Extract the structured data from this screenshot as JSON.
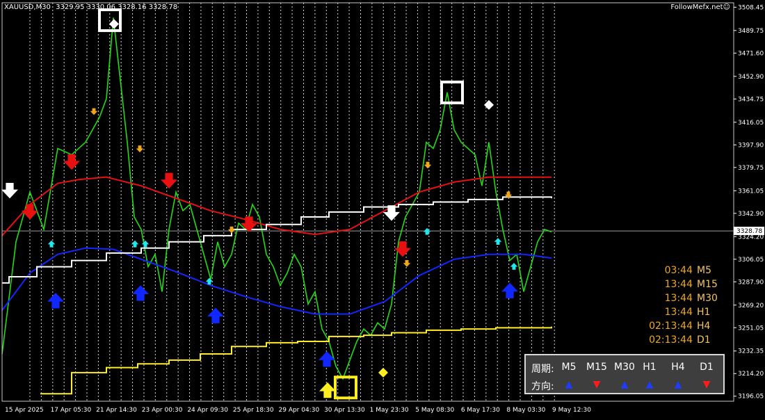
{
  "window": {
    "symbol": "XAUUSD,M30",
    "ohlc": "3329.95 3330.06 3328.16 3328.78",
    "brand": "FollowMefx.net",
    "brand_icon": "smiley-icon"
  },
  "current_price_label": "3328.78",
  "timeframe_list": [
    {
      "time": "03:44",
      "tf": "M5"
    },
    {
      "time": "13:44",
      "tf": "M15"
    },
    {
      "time": "13:44",
      "tf": "M30"
    },
    {
      "time": "13:44",
      "tf": "H1"
    },
    {
      "time": "02:13:44",
      "tf": "H4"
    },
    {
      "time": "02:13:44",
      "tf": "D1"
    }
  ],
  "direction_panel": {
    "period_label": "周期:",
    "direction_label": "方向:",
    "columns": [
      {
        "tf": "M5",
        "dir": "up",
        "glyph": "▲"
      },
      {
        "tf": "M15",
        "dir": "down",
        "glyph": "▼"
      },
      {
        "tf": "M30",
        "dir": "up",
        "glyph": "▲"
      },
      {
        "tf": "H1",
        "dir": "up",
        "glyph": "▲"
      },
      {
        "tf": "H4",
        "dir": "up",
        "glyph": "▲"
      },
      {
        "tf": "D1",
        "dir": "down",
        "glyph": "▼"
      }
    ]
  },
  "colors": {
    "background": "#000000",
    "price": "#22dd11",
    "red_ma": "#e81010",
    "blue_ma": "#1028ff",
    "white_step": "#ffffff",
    "yellow_step": "#ffee22",
    "orange_arrow": "#f0a818",
    "cyan_arrow": "#22e8ee",
    "up_dir": "#1f3bff",
    "down_dir": "#ff1b1b"
  },
  "chart_data": {
    "type": "line",
    "title": "",
    "y_ticks": [
      "3508.45",
      "3489.75",
      "3471.60",
      "3452.90",
      "3434.75",
      "3416.05",
      "3397.90",
      "3379.75",
      "3361.05",
      "3342.90",
      "3324.20",
      "3306.05",
      "3287.90",
      "3269.20",
      "3251.05",
      "3232.35",
      "3214.20",
      "3196.05"
    ],
    "x_ticks": [
      "15 Apr 2025",
      "17 Apr 05:30",
      "21 Apr 14:30",
      "23 Apr 00:30",
      "24 Apr 09:30",
      "25 Apr 18:30",
      "29 Apr 04:30",
      "30 Apr 13:30",
      "1 May 23:30",
      "5 May 08:30",
      "6 May 17:30",
      "8 May 03:30",
      "9 May 12:30"
    ],
    "ylim": [
      3192,
      3512
    ],
    "grid": "vertical-dotted",
    "last_price": 3328.78,
    "series": [
      {
        "name": "",
        "style": "price-line",
        "x": [
          0,
          20,
          40,
          60,
          80,
          100,
          120,
          140,
          150,
          160,
          170,
          180,
          190,
          200,
          210,
          220,
          230,
          240,
          250,
          260,
          270,
          280,
          290,
          300,
          310,
          320,
          330,
          340,
          350,
          360,
          370,
          380,
          390,
          400,
          410,
          420,
          430,
          440,
          450,
          460,
          470,
          480,
          490,
          500,
          510,
          520,
          530,
          540,
          550,
          560,
          570,
          580,
          590,
          600,
          610,
          620,
          630,
          640,
          650,
          660,
          670,
          680,
          690,
          700,
          710,
          720,
          730,
          740,
          750,
          760,
          770,
          780,
          790
        ],
        "y": [
          3230,
          3320,
          3360,
          3330,
          3395,
          3390,
          3400,
          3420,
          3435,
          3500,
          3450,
          3400,
          3340,
          3330,
          3300,
          3310,
          3280,
          3330,
          3360,
          3345,
          3350,
          3330,
          3310,
          3290,
          3320,
          3300,
          3310,
          3335,
          3330,
          3350,
          3340,
          3310,
          3300,
          3285,
          3295,
          3310,
          3300,
          3270,
          3280,
          3250,
          3240,
          3220,
          3210,
          3225,
          3240,
          3250,
          3245,
          3255,
          3250,
          3270,
          3320,
          3340,
          3350,
          3360,
          3400,
          3395,
          3410,
          3440,
          3410,
          3400,
          3395,
          3390,
          3365,
          3400,
          3360,
          3330,
          3305,
          3310,
          3280,
          3300,
          3320,
          3330,
          3328
        ]
      },
      {
        "name": "",
        "style": "red-ma",
        "x": [
          0,
          40,
          80,
          110,
          150,
          200,
          250,
          300,
          350,
          400,
          450,
          500,
          550,
          600,
          650,
          700,
          720,
          790
        ],
        "y": [
          3325,
          3350,
          3367,
          3370,
          3372,
          3365,
          3355,
          3345,
          3338,
          3330,
          3326,
          3330,
          3345,
          3360,
          3368,
          3372,
          3372,
          3372
        ]
      },
      {
        "name": "",
        "style": "blue-ma",
        "x": [
          0,
          40,
          80,
          120,
          160,
          200,
          250,
          300,
          350,
          400,
          450,
          500,
          550,
          600,
          650,
          700,
          750,
          790
        ],
        "y": [
          3265,
          3295,
          3310,
          3315,
          3314,
          3306,
          3296,
          3285,
          3276,
          3268,
          3262,
          3262,
          3272,
          3293,
          3306,
          3310,
          3310,
          3307
        ]
      },
      {
        "name": "",
        "style": "white-step",
        "x": [
          0,
          10,
          50,
          100,
          150,
          200,
          240,
          290,
          330,
          380,
          430,
          470,
          520,
          570,
          620,
          670,
          720,
          790
        ],
        "y": [
          3287,
          3292,
          3300,
          3305,
          3311,
          3315,
          3320,
          3325,
          3330,
          3334,
          3340,
          3344,
          3348,
          3350,
          3352,
          3354,
          3356,
          3355
        ]
      },
      {
        "name": "",
        "style": "yellow-step",
        "x": [
          55,
          100,
          150,
          195,
          240,
          285,
          330,
          380,
          425,
          470,
          520,
          560,
          610,
          660,
          710,
          790
        ],
        "y": [
          3198,
          3215,
          3219,
          3222,
          3225,
          3230,
          3236,
          3239,
          3240,
          3244,
          3245,
          3247,
          3249,
          3250,
          3251,
          3252
        ]
      }
    ],
    "markers": [
      {
        "kind": "red-down-arrow",
        "x": 100,
        "y": 3385
      },
      {
        "kind": "red-down-arrow",
        "x": 40,
        "y": 3345
      },
      {
        "kind": "red-down-arrow",
        "x": 240,
        "y": 3370
      },
      {
        "kind": "red-down-arrow",
        "x": 355,
        "y": 3335
      },
      {
        "kind": "red-down-arrow",
        "x": 576,
        "y": 3315
      },
      {
        "kind": "white-down-arrow",
        "x": 11,
        "y": 3362
      },
      {
        "kind": "white-down-arrow",
        "x": 560,
        "y": 3344
      },
      {
        "kind": "blue-up-arrow",
        "x": 77,
        "y": 3272
      },
      {
        "kind": "blue-up-arrow",
        "x": 199,
        "y": 3278
      },
      {
        "kind": "blue-up-arrow",
        "x": 307,
        "y": 3260
      },
      {
        "kind": "blue-up-arrow",
        "x": 467,
        "y": 3225
      },
      {
        "kind": "blue-up-arrow",
        "x": 730,
        "y": 3280
      },
      {
        "kind": "yellow-up-arrow",
        "x": 468,
        "y": 3200
      },
      {
        "kind": "orange-arrow",
        "x": 132,
        "y": 3425
      },
      {
        "kind": "orange-arrow",
        "x": 198,
        "y": 3395
      },
      {
        "kind": "orange-arrow",
        "x": 330,
        "y": 3330
      },
      {
        "kind": "orange-arrow",
        "x": 582,
        "y": 3303
      },
      {
        "kind": "orange-arrow",
        "x": 612,
        "y": 3382
      },
      {
        "kind": "orange-arrow",
        "x": 728,
        "y": 3358
      },
      {
        "kind": "cyan-arrow",
        "x": 71,
        "y": 3318
      },
      {
        "kind": "cyan-arrow",
        "x": 191,
        "y": 3318
      },
      {
        "kind": "cyan-arrow",
        "x": 206,
        "y": 3318
      },
      {
        "kind": "cyan-arrow",
        "x": 298,
        "y": 3288
      },
      {
        "kind": "cyan-arrow",
        "x": 611,
        "y": 3328
      },
      {
        "kind": "cyan-arrow",
        "x": 713,
        "y": 3320
      },
      {
        "kind": "cyan-arrow",
        "x": 736,
        "y": 3300
      },
      {
        "kind": "white-square",
        "x": 155,
        "y": 3498
      },
      {
        "kind": "white-square",
        "x": 647,
        "y": 3440
      },
      {
        "kind": "yellow-square",
        "x": 494,
        "y": 3203
      },
      {
        "kind": "white-diamond",
        "x": 161,
        "y": 3495
      },
      {
        "kind": "white-diamond",
        "x": 700,
        "y": 3430
      },
      {
        "kind": "yellow-diamond",
        "x": 548,
        "y": 3215
      }
    ]
  }
}
